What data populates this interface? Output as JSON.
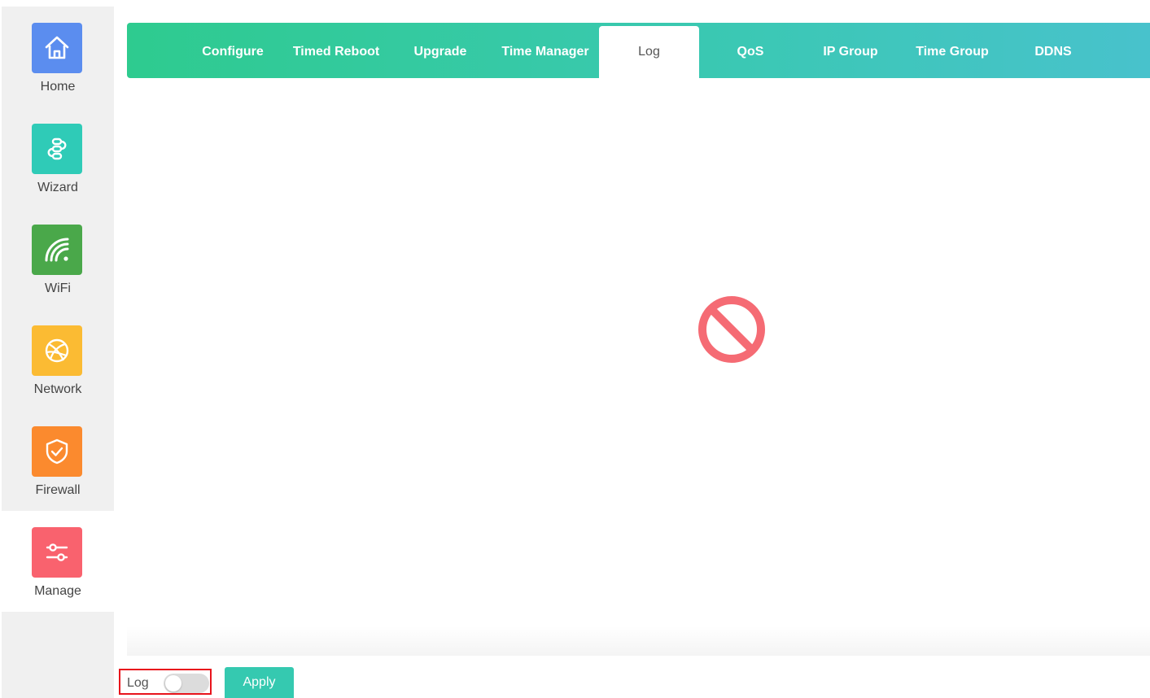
{
  "sidebar": {
    "items": [
      {
        "label": "Home",
        "icon": "home-icon",
        "color": "#5b8def",
        "active": false
      },
      {
        "label": "Wizard",
        "icon": "wizard-icon",
        "color": "#2fcbb7",
        "active": false
      },
      {
        "label": "WiFi",
        "icon": "wifi-icon",
        "color": "#4aa84a",
        "active": false
      },
      {
        "label": "Network",
        "icon": "network-globe-icon",
        "color": "#fbbb33",
        "active": false
      },
      {
        "label": "Firewall",
        "icon": "firewall-shield-icon",
        "color": "#fb8a2e",
        "active": false
      },
      {
        "label": "Manage",
        "icon": "manage-sliders-icon",
        "color": "#f9626e",
        "active": true
      }
    ]
  },
  "tabs": {
    "items": [
      {
        "label": "Configure",
        "active": false
      },
      {
        "label": "Timed Reboot",
        "active": false
      },
      {
        "label": "Upgrade",
        "active": false
      },
      {
        "label": "Time Manager",
        "active": false
      },
      {
        "label": "Log",
        "active": true
      },
      {
        "label": "QoS",
        "active": false
      },
      {
        "label": "IP Group",
        "active": false
      },
      {
        "label": "Time Group",
        "active": false
      },
      {
        "label": "DDNS",
        "active": false
      }
    ]
  },
  "content": {
    "status_icon": "blocked-icon",
    "status_color": "#f56b74"
  },
  "footer": {
    "log_label": "Log",
    "log_enabled": false,
    "apply_label": "Apply"
  },
  "colors": {
    "accent": "#35c9b0",
    "highlight_border": "#e8141c"
  }
}
